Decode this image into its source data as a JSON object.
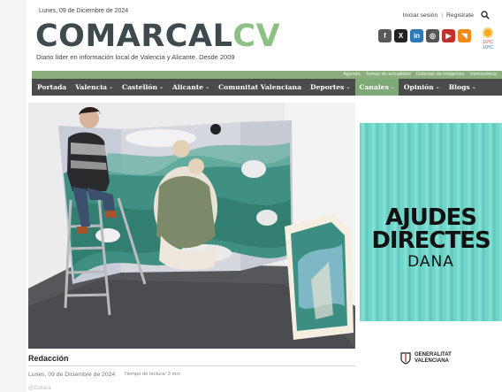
{
  "header": {
    "date": "Lunes, 09 de Diciembre de 2024",
    "logo_part1": "COMARCAL",
    "logo_part2": "CV",
    "tagline": "Diario líder en información local de Valencia y Alicante. Desde 2009",
    "login": "Iniciar sesión",
    "register": "Registrate",
    "social": [
      {
        "icon": "facebook-icon",
        "glyph": "f",
        "color": "#5a5a5a"
      },
      {
        "icon": "x-icon",
        "glyph": "X",
        "color": "#222222"
      },
      {
        "icon": "linkedin-icon",
        "glyph": "in",
        "color": "#2f78b5"
      },
      {
        "icon": "instagram-icon",
        "glyph": "◎",
        "color": "#555555"
      },
      {
        "icon": "youtube-icon",
        "glyph": "▶",
        "color": "#c4302b"
      },
      {
        "icon": "rss-icon",
        "glyph": "◥",
        "color": "#f28a1a"
      }
    ],
    "weather": {
      "high": "16ºC",
      "low": "10ºC",
      "icon": "sun-icon"
    }
  },
  "subnav": [
    "Agenda",
    "Temas de actualidad",
    "Galerías de imágenes",
    "Hemeroteca"
  ],
  "nav": [
    {
      "label": "Portada",
      "chevron": false
    },
    {
      "label": "Valencia",
      "chevron": true
    },
    {
      "label": "Castellón",
      "chevron": true
    },
    {
      "label": "Alicante",
      "chevron": true
    },
    {
      "label": "Comunitat Valenciana",
      "chevron": false
    },
    {
      "label": "Deportes",
      "chevron": true
    },
    {
      "label": "Canales",
      "chevron": true,
      "active": true
    },
    {
      "label": "Opinión",
      "chevron": true
    },
    {
      "label": "Blogs",
      "chevron": true
    }
  ],
  "ad": {
    "line1": "AJUDES",
    "line2": "DIRECTES",
    "line3": "DANA",
    "sponsor_line1": "GENERALITAT",
    "sponsor_line2": "VALENCIANA"
  },
  "article": {
    "author": "Redacción",
    "date": "Lunes, 09 de Diciembre de 2024",
    "reading_time": "Tiempo de lectura: 3 min",
    "faded": "@Cultura"
  },
  "colors": {
    "accent_green": "#8dc084",
    "nav_bg": "#4a4b4a",
    "subbar_bg": "#8aae7c"
  }
}
